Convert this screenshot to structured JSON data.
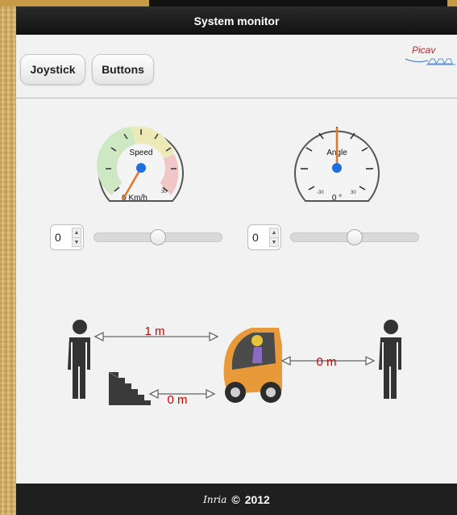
{
  "header": {
    "title": "System monitor"
  },
  "toolbar": {
    "joystick_label": "Joystick",
    "buttons_label": "Buttons"
  },
  "logo": {
    "text": "Picav"
  },
  "speed_gauge": {
    "title": "Speed",
    "readout": "0 Km/h",
    "max_label": "30",
    "needle_angle_deg": -150,
    "value": 0
  },
  "angle_gauge": {
    "title": "Angle",
    "readout": "0 °",
    "min_label": "-30",
    "max_label": "30",
    "needle_angle_deg": 0,
    "value": 0
  },
  "speed_control": {
    "value": "0",
    "slider_position": 0.5
  },
  "angle_control": {
    "value": "0",
    "slider_position": 0.5
  },
  "distances": {
    "rear_person": "1 m",
    "stairs": "0 m",
    "front_person": "0 m"
  },
  "footer": {
    "brand": "Inria",
    "copyright": "©",
    "year": "2012"
  },
  "colors": {
    "distance_text": "#cc0000",
    "needle": "#e8742a",
    "hub": "#1e6fe0"
  }
}
